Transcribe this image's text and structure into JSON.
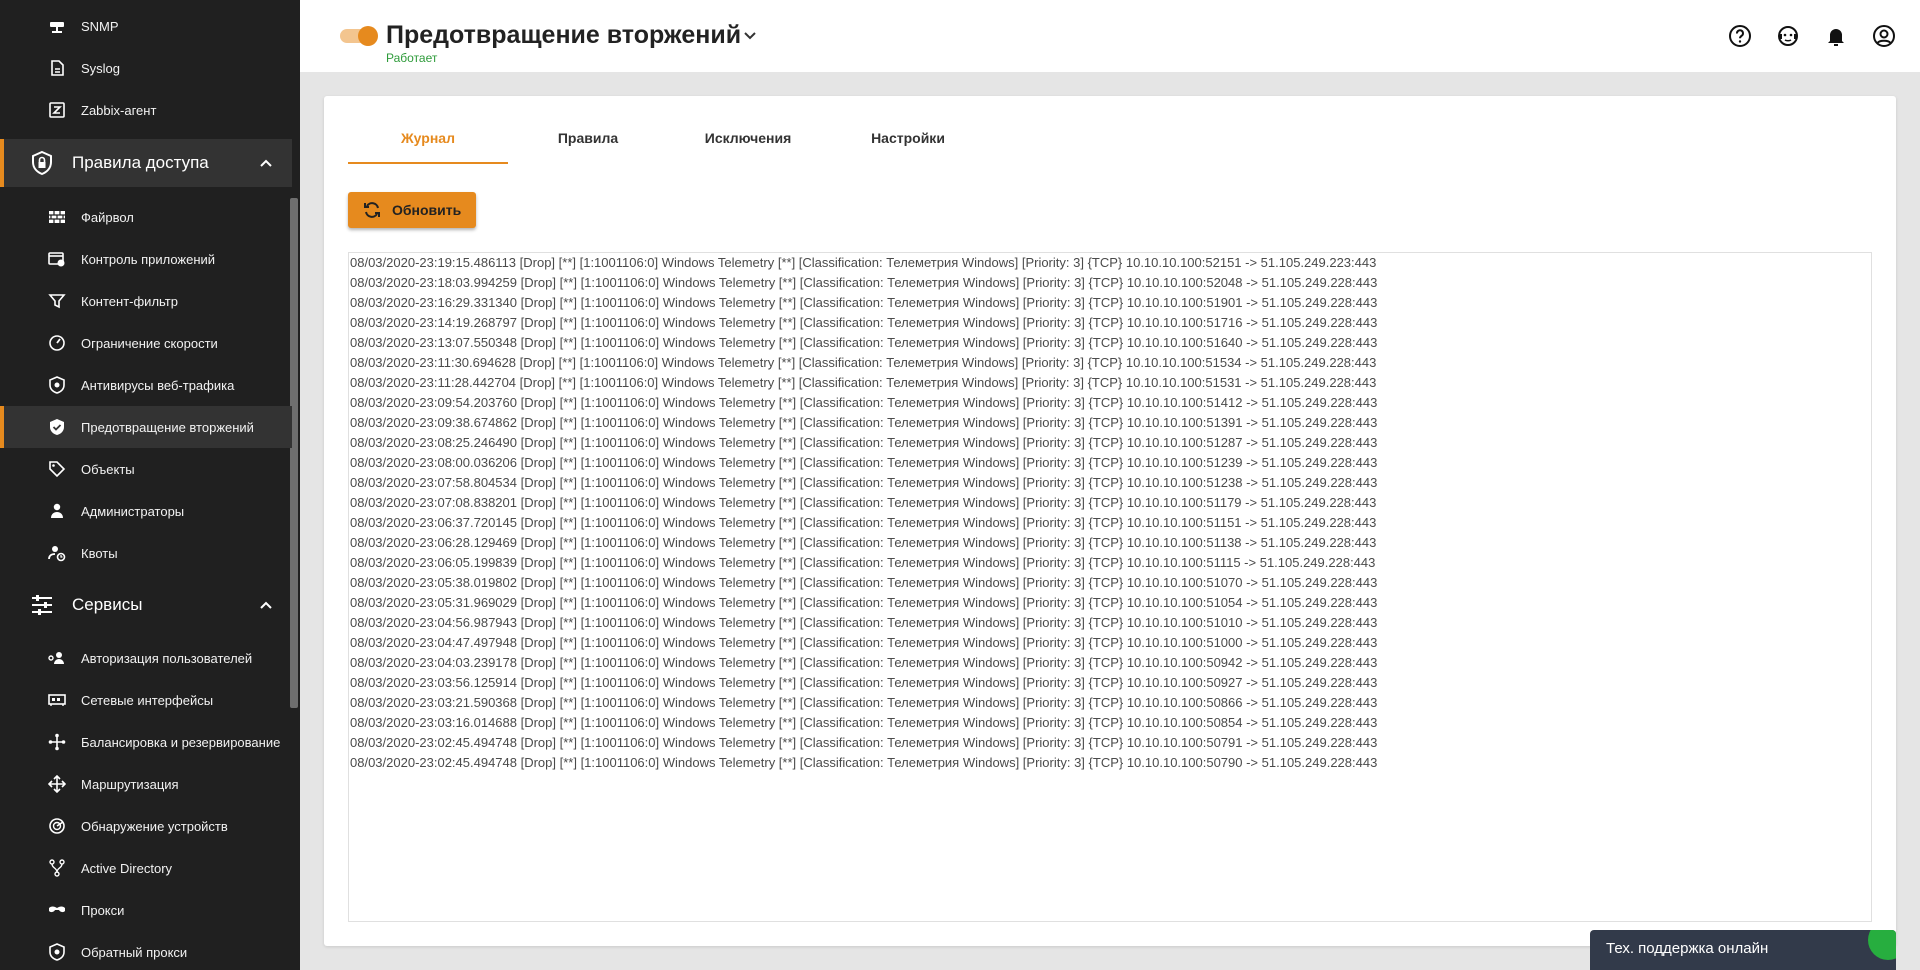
{
  "sidebar": {
    "items_top": [
      {
        "label": "SNMP",
        "icon": "snmp-icon"
      },
      {
        "label": "Syslog",
        "icon": "document-icon"
      },
      {
        "label": "Zabbix-агент",
        "icon": "zabbix-icon"
      }
    ],
    "section_access": {
      "label": "Правила доступа",
      "icon": "shield-lock-icon"
    },
    "items_access": [
      {
        "label": "Файрвол",
        "icon": "brick-wall-icon"
      },
      {
        "label": "Контроль приложений",
        "icon": "app-control-icon"
      },
      {
        "label": "Контент-фильтр",
        "icon": "filter-icon"
      },
      {
        "label": "Ограничение скорости",
        "icon": "speedometer-icon"
      },
      {
        "label": "Антивирусы веб-трафика",
        "icon": "shield-virus-icon"
      },
      {
        "label": "Предотвращение вторжений",
        "icon": "shield-check-icon"
      },
      {
        "label": "Объекты",
        "icon": "tag-icon"
      },
      {
        "label": "Администраторы",
        "icon": "admin-icon"
      },
      {
        "label": "Квоты",
        "icon": "quota-icon"
      }
    ],
    "section_services": {
      "label": "Сервисы",
      "icon": "sliders-icon"
    },
    "items_services": [
      {
        "label": "Авторизация пользователей",
        "icon": "user-auth-icon"
      },
      {
        "label": "Сетевые интерфейсы",
        "icon": "network-card-icon"
      },
      {
        "label": "Балансировка и резервирование",
        "icon": "balance-icon"
      },
      {
        "label": "Маршрутизация",
        "icon": "routing-icon"
      },
      {
        "label": "Обнаружение устройств",
        "icon": "radar-icon"
      },
      {
        "label": "Active Directory",
        "icon": "ad-tree-icon"
      },
      {
        "label": "Прокси",
        "icon": "proxy-icon"
      },
      {
        "label": "Обратный прокси",
        "icon": "reverse-proxy-icon"
      }
    ]
  },
  "header": {
    "title": "Предотвращение вторжений",
    "status": "Работает",
    "enabled": true,
    "accent_color": "#e68a1e",
    "status_color": "#2e9b3a",
    "icons": [
      "help-icon",
      "support-icon",
      "bell-icon",
      "account-icon"
    ]
  },
  "tabs": [
    {
      "label": "Журнал",
      "active": true
    },
    {
      "label": "Правила",
      "active": false
    },
    {
      "label": "Исключения",
      "active": false
    },
    {
      "label": "Настройки",
      "active": false
    }
  ],
  "refresh_label": "Обновить",
  "log_lines": [
    "08/03/2020-23:19:15.486113 [Drop] [**] [1:1001106:0] Windows Telemetry [**] [Classification: Телеметрия Windows] [Priority: 3] {TCP} 10.10.10.100:52151 -> 51.105.249.223:443",
    "08/03/2020-23:18:03.994259 [Drop] [**] [1:1001106:0] Windows Telemetry [**] [Classification: Телеметрия Windows] [Priority: 3] {TCP} 10.10.10.100:52048 -> 51.105.249.228:443",
    "08/03/2020-23:16:29.331340 [Drop] [**] [1:1001106:0] Windows Telemetry [**] [Classification: Телеметрия Windows] [Priority: 3] {TCP} 10.10.10.100:51901 -> 51.105.249.228:443",
    "08/03/2020-23:14:19.268797 [Drop] [**] [1:1001106:0] Windows Telemetry [**] [Classification: Телеметрия Windows] [Priority: 3] {TCP} 10.10.10.100:51716 -> 51.105.249.228:443",
    "08/03/2020-23:13:07.550348 [Drop] [**] [1:1001106:0] Windows Telemetry [**] [Classification: Телеметрия Windows] [Priority: 3] {TCP} 10.10.10.100:51640 -> 51.105.249.228:443",
    "08/03/2020-23:11:30.694628 [Drop] [**] [1:1001106:0] Windows Telemetry [**] [Classification: Телеметрия Windows] [Priority: 3] {TCP} 10.10.10.100:51534 -> 51.105.249.228:443",
    "08/03/2020-23:11:28.442704 [Drop] [**] [1:1001106:0] Windows Telemetry [**] [Classification: Телеметрия Windows] [Priority: 3] {TCP} 10.10.10.100:51531 -> 51.105.249.228:443",
    "08/03/2020-23:09:54.203760 [Drop] [**] [1:1001106:0] Windows Telemetry [**] [Classification: Телеметрия Windows] [Priority: 3] {TCP} 10.10.10.100:51412 -> 51.105.249.228:443",
    "08/03/2020-23:09:38.674862 [Drop] [**] [1:1001106:0] Windows Telemetry [**] [Classification: Телеметрия Windows] [Priority: 3] {TCP} 10.10.10.100:51391 -> 51.105.249.228:443",
    "08/03/2020-23:08:25.246490 [Drop] [**] [1:1001106:0] Windows Telemetry [**] [Classification: Телеметрия Windows] [Priority: 3] {TCP} 10.10.10.100:51287 -> 51.105.249.228:443",
    "08/03/2020-23:08:00.036206 [Drop] [**] [1:1001106:0] Windows Telemetry [**] [Classification: Телеметрия Windows] [Priority: 3] {TCP} 10.10.10.100:51239 -> 51.105.249.228:443",
    "08/03/2020-23:07:58.804534 [Drop] [**] [1:1001106:0] Windows Telemetry [**] [Classification: Телеметрия Windows] [Priority: 3] {TCP} 10.10.10.100:51238 -> 51.105.249.228:443",
    "08/03/2020-23:07:08.838201 [Drop] [**] [1:1001106:0] Windows Telemetry [**] [Classification: Телеметрия Windows] [Priority: 3] {TCP} 10.10.10.100:51179 -> 51.105.249.228:443",
    "08/03/2020-23:06:37.720145 [Drop] [**] [1:1001106:0] Windows Telemetry [**] [Classification: Телеметрия Windows] [Priority: 3] {TCP} 10.10.10.100:51151 -> 51.105.249.228:443",
    "08/03/2020-23:06:28.129469 [Drop] [**] [1:1001106:0] Windows Telemetry [**] [Classification: Телеметрия Windows] [Priority: 3] {TCP} 10.10.10.100:51138 -> 51.105.249.228:443",
    "08/03/2020-23:06:05.199839 [Drop] [**] [1:1001106:0] Windows Telemetry [**] [Classification: Телеметрия Windows] [Priority: 3] {TCP} 10.10.10.100:51115 -> 51.105.249.228:443",
    "08/03/2020-23:05:38.019802 [Drop] [**] [1:1001106:0] Windows Telemetry [**] [Classification: Телеметрия Windows] [Priority: 3] {TCP} 10.10.10.100:51070 -> 51.105.249.228:443",
    "08/03/2020-23:05:31.969029 [Drop] [**] [1:1001106:0] Windows Telemetry [**] [Classification: Телеметрия Windows] [Priority: 3] {TCP} 10.10.10.100:51054 -> 51.105.249.228:443",
    "08/03/2020-23:04:56.987943 [Drop] [**] [1:1001106:0] Windows Telemetry [**] [Classification: Телеметрия Windows] [Priority: 3] {TCP} 10.10.10.100:51010 -> 51.105.249.228:443",
    "08/03/2020-23:04:47.497948 [Drop] [**] [1:1001106:0] Windows Telemetry [**] [Classification: Телеметрия Windows] [Priority: 3] {TCP} 10.10.10.100:51000 -> 51.105.249.228:443",
    "08/03/2020-23:04:03.239178 [Drop] [**] [1:1001106:0] Windows Telemetry [**] [Classification: Телеметрия Windows] [Priority: 3] {TCP} 10.10.10.100:50942 -> 51.105.249.228:443",
    "08/03/2020-23:03:56.125914 [Drop] [**] [1:1001106:0] Windows Telemetry [**] [Classification: Телеметрия Windows] [Priority: 3] {TCP} 10.10.10.100:50927 -> 51.105.249.228:443",
    "08/03/2020-23:03:21.590368 [Drop] [**] [1:1001106:0] Windows Telemetry [**] [Classification: Телеметрия Windows] [Priority: 3] {TCP} 10.10.10.100:50866 -> 51.105.249.228:443",
    "08/03/2020-23:03:16.014688 [Drop] [**] [1:1001106:0] Windows Telemetry [**] [Classification: Телеметрия Windows] [Priority: 3] {TCP} 10.10.10.100:50854 -> 51.105.249.228:443",
    "08/03/2020-23:02:45.494748 [Drop] [**] [1:1001106:0] Windows Telemetry [**] [Classification: Телеметрия Windows] [Priority: 3] {TCP} 10.10.10.100:50791 -> 51.105.249.228:443",
    "08/03/2020-23:02:45.494748 [Drop] [**] [1:1001106:0] Windows Telemetry [**] [Classification: Телеметрия Windows] [Priority: 3] {TCP} 10.10.10.100:50790 -> 51.105.249.228:443"
  ],
  "chat": {
    "label": "Тех. поддержка онлайн",
    "online_color": "#27ae3f"
  }
}
